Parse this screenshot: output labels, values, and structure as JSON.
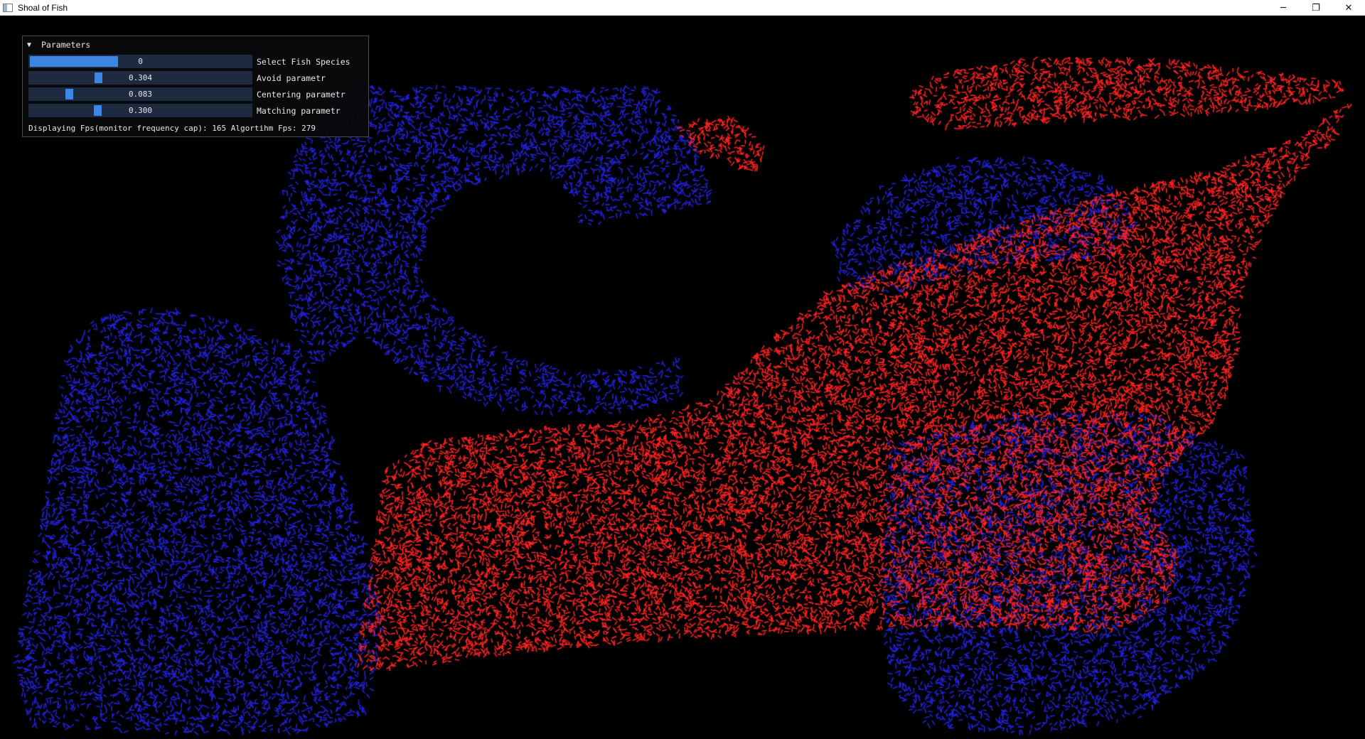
{
  "window": {
    "title": "Shoal of Fish",
    "minimize_glyph": "─",
    "restore_glyph": "❐",
    "close_glyph": "✕"
  },
  "panel": {
    "collapse_glyph": "▼",
    "title": "Parameters",
    "sliders": [
      {
        "label": "Select Fish Species",
        "display": "0",
        "value": 0,
        "min": 0,
        "max": 1,
        "style": "fill"
      },
      {
        "label": "Avoid parametr",
        "display": "0.304",
        "value": 0.304,
        "min": 0,
        "max": 1,
        "style": "grab"
      },
      {
        "label": "Centering parametr",
        "display": "0.083",
        "value": 0.083,
        "min": 0,
        "max": 0.5,
        "style": "grab"
      },
      {
        "label": "Matching parametr",
        "display": "0.300",
        "value": 0.3,
        "min": 0,
        "max": 1,
        "style": "grab"
      }
    ],
    "fps_text": "Displaying Fps(monitor frequency cap): 165 Algortihm Fps: 279"
  },
  "colors": {
    "species_1": "#2222dd",
    "species_2": "#ff2222",
    "background": "#000000",
    "accent": "#3d86e3"
  }
}
